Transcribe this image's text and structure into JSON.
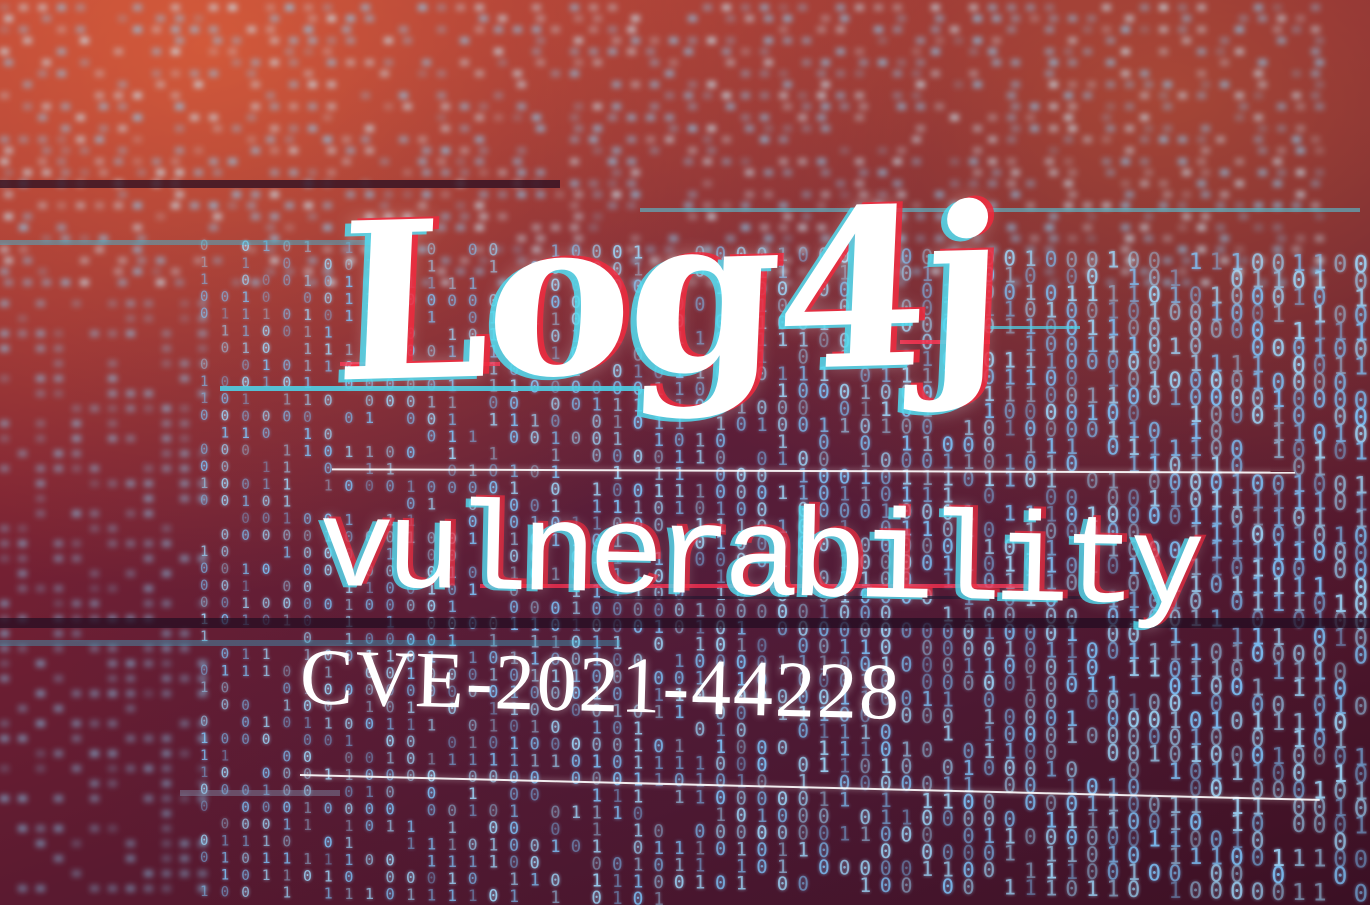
{
  "image": {
    "title_text": "Log4j",
    "subtitle_text": "vulnerability",
    "cve_text": "CVE-2021-44228",
    "colors": {
      "background_red": "#7a2234",
      "glitch_cyan": "#50dcf0",
      "glitch_red": "#f0283c",
      "text_white": "#ffffff",
      "matrix_blue": "#8fd3ff"
    }
  }
}
